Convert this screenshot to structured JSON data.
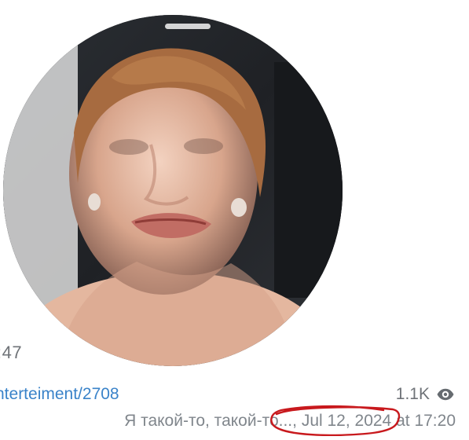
{
  "message": {
    "duration": ":47",
    "link_text": "nterteiment/2708",
    "views": "1.1K",
    "author_signature": "Я такой-то, такой-то...,",
    "date": "Jul 12, 2024",
    "time_label": "at 17:20"
  },
  "icons": {
    "views": "eye-icon",
    "annotation": "red-hand-drawn-circle"
  },
  "colors": {
    "link": "#3a83c9",
    "meta_text": "#80868c",
    "annotation": "#c8191d"
  }
}
